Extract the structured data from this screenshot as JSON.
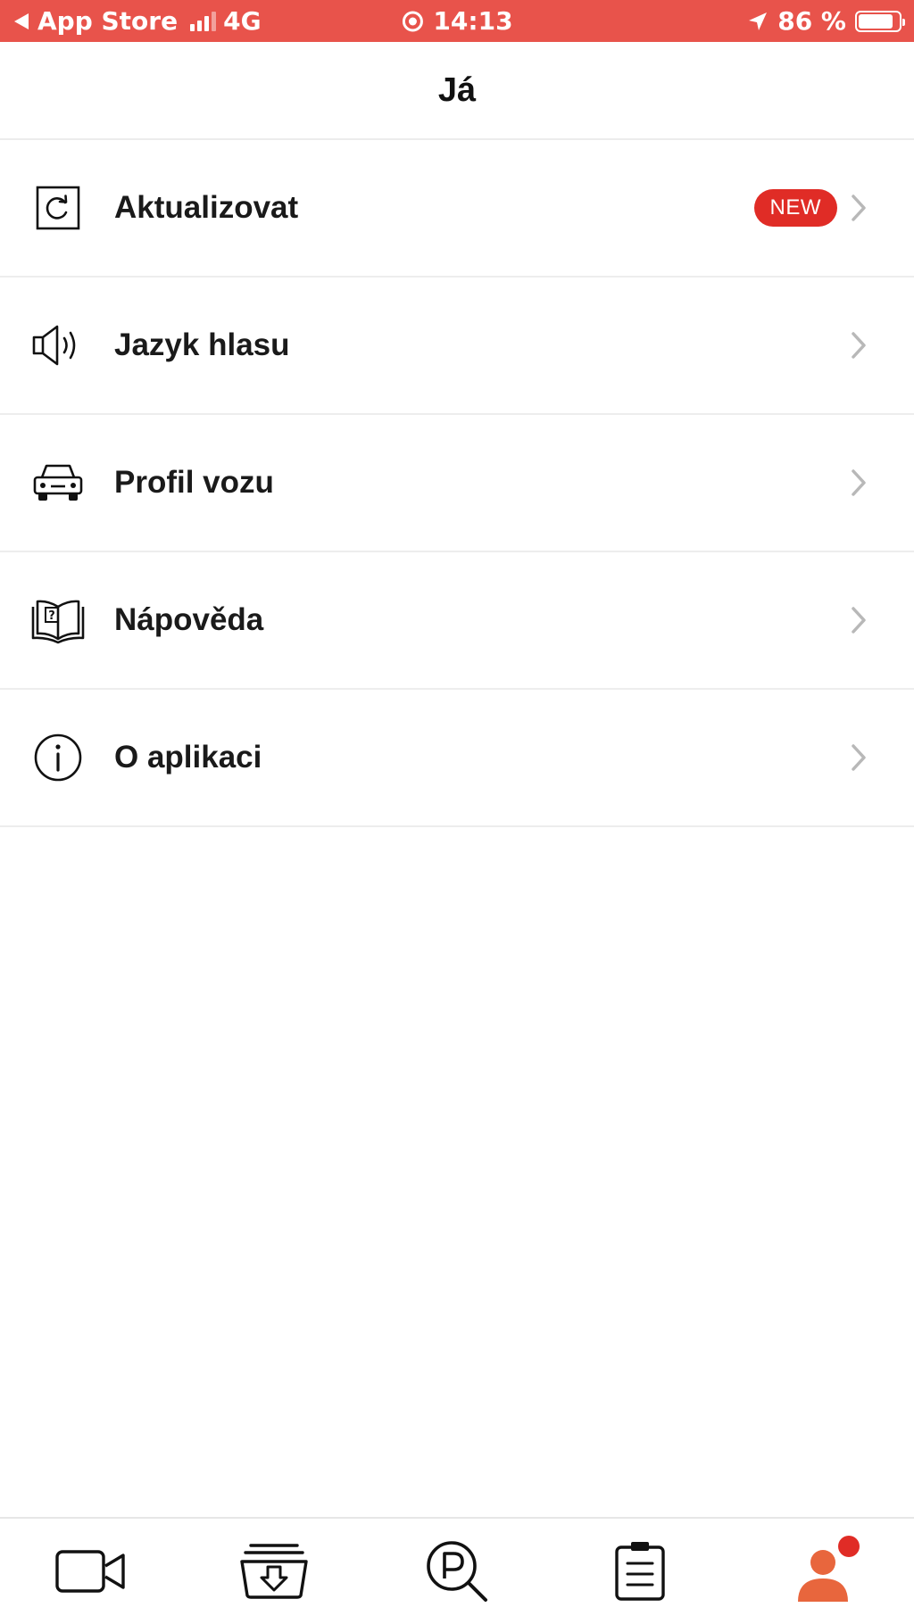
{
  "status_bar": {
    "back_app": "App Store",
    "network": "4G",
    "time": "14:13",
    "battery": "86 %",
    "battery_level": 0.86,
    "background_color": "#e8534b"
  },
  "header": {
    "title": "Já"
  },
  "menu": {
    "items": [
      {
        "label": "Aktualizovat",
        "icon": "refresh-icon",
        "badge": "NEW"
      },
      {
        "label": "Jazyk hlasu",
        "icon": "speaker-icon"
      },
      {
        "label": "Profil vozu",
        "icon": "car-icon"
      },
      {
        "label": "Nápověda",
        "icon": "help-book-icon"
      },
      {
        "label": "O aplikaci",
        "icon": "info-icon"
      }
    ]
  },
  "tab_bar": {
    "tabs": [
      {
        "icon": "video-camera-icon"
      },
      {
        "icon": "download-tray-icon"
      },
      {
        "icon": "parking-search-icon"
      },
      {
        "icon": "clipboard-icon"
      },
      {
        "icon": "profile-icon",
        "active": true,
        "notification_dot": true
      }
    ],
    "active_color": "#e8663d",
    "badge_color": "#e02c26"
  }
}
